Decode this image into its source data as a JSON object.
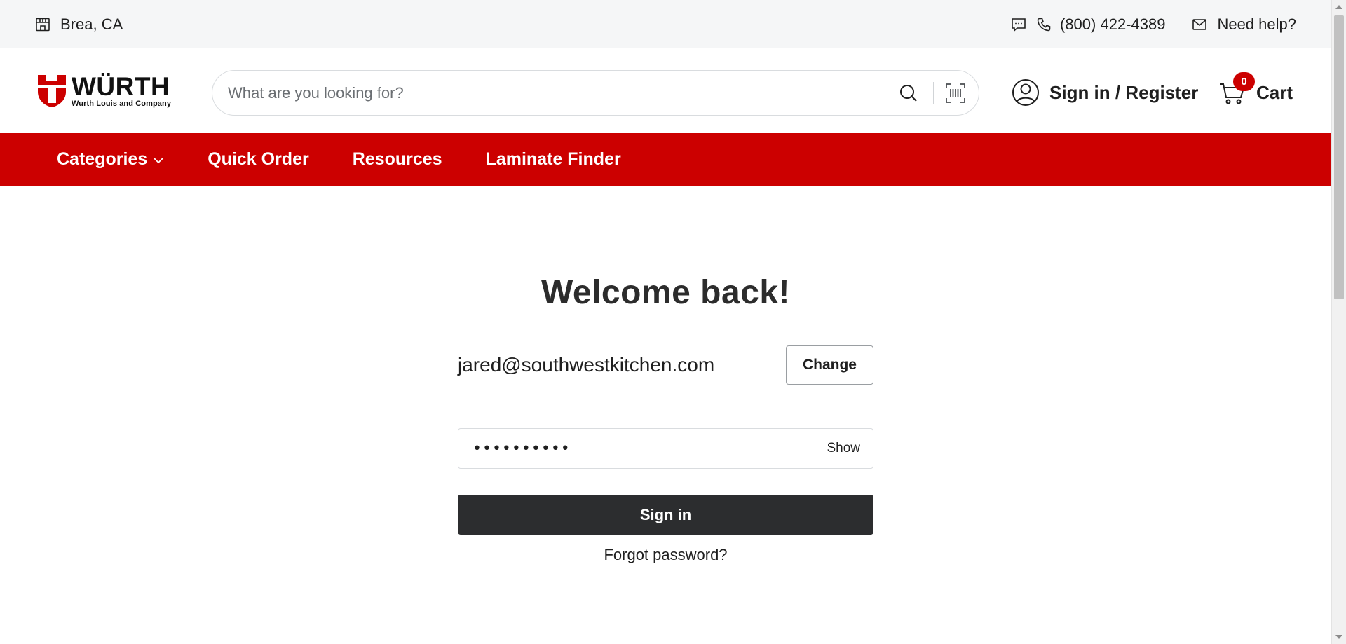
{
  "utility_bar": {
    "location": "Brea, CA",
    "phone": "(800) 422-4389",
    "help": "Need help?"
  },
  "header": {
    "logo_word": "WÜRTH",
    "logo_sub": "Wurth Louis and Company",
    "search_placeholder": "What are you looking for?",
    "account_label": "Sign in / Register",
    "cart_label": "Cart",
    "cart_count": "0"
  },
  "nav": {
    "items": [
      {
        "label": "Categories"
      },
      {
        "label": "Quick Order"
      },
      {
        "label": "Resources"
      },
      {
        "label": "Laminate Finder"
      }
    ]
  },
  "signin": {
    "title": "Welcome back!",
    "email": "jared@southwestkitchen.com",
    "change_label": "Change",
    "password_value": "••••••••••",
    "show_label": "Show",
    "submit_label": "Sign in",
    "forgot_label": "Forgot password?"
  },
  "colors": {
    "brand_red": "#cc0000",
    "button_dark": "#2c2d2f",
    "utility_bg": "#f5f6f7"
  }
}
